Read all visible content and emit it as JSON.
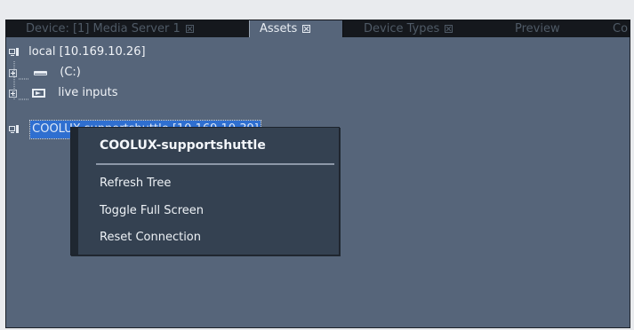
{
  "tabs": [
    {
      "label": "Device: [1] Media Server 1",
      "closable": true,
      "active": false
    },
    {
      "label": "Assets",
      "closable": true,
      "active": true
    },
    {
      "label": "Device Types",
      "closable": true,
      "active": false
    },
    {
      "label": "Preview",
      "closable": false,
      "active": false
    },
    {
      "label": "Co",
      "closable": false,
      "active": false
    }
  ],
  "tree": {
    "nodes": [
      {
        "label": "local [10.169.10.26]",
        "icon": "computer-icon"
      },
      {
        "label": "(C:)",
        "icon": "drive-icon"
      },
      {
        "label": "live inputs",
        "icon": "live-input-icon"
      },
      {
        "label": "COOLUX-supportshuttle [10.169.10.39]",
        "icon": "computer-icon",
        "selected": true
      }
    ]
  },
  "context_menu": {
    "title": "COOLUX-supportshuttle",
    "items": [
      "Refresh Tree",
      "Toggle Full Screen",
      "Reset Connection"
    ]
  },
  "colors": {
    "panel": "#56657a",
    "tabbar": "#15181d",
    "menu": "#344151",
    "selection": "#2f6fd0"
  }
}
